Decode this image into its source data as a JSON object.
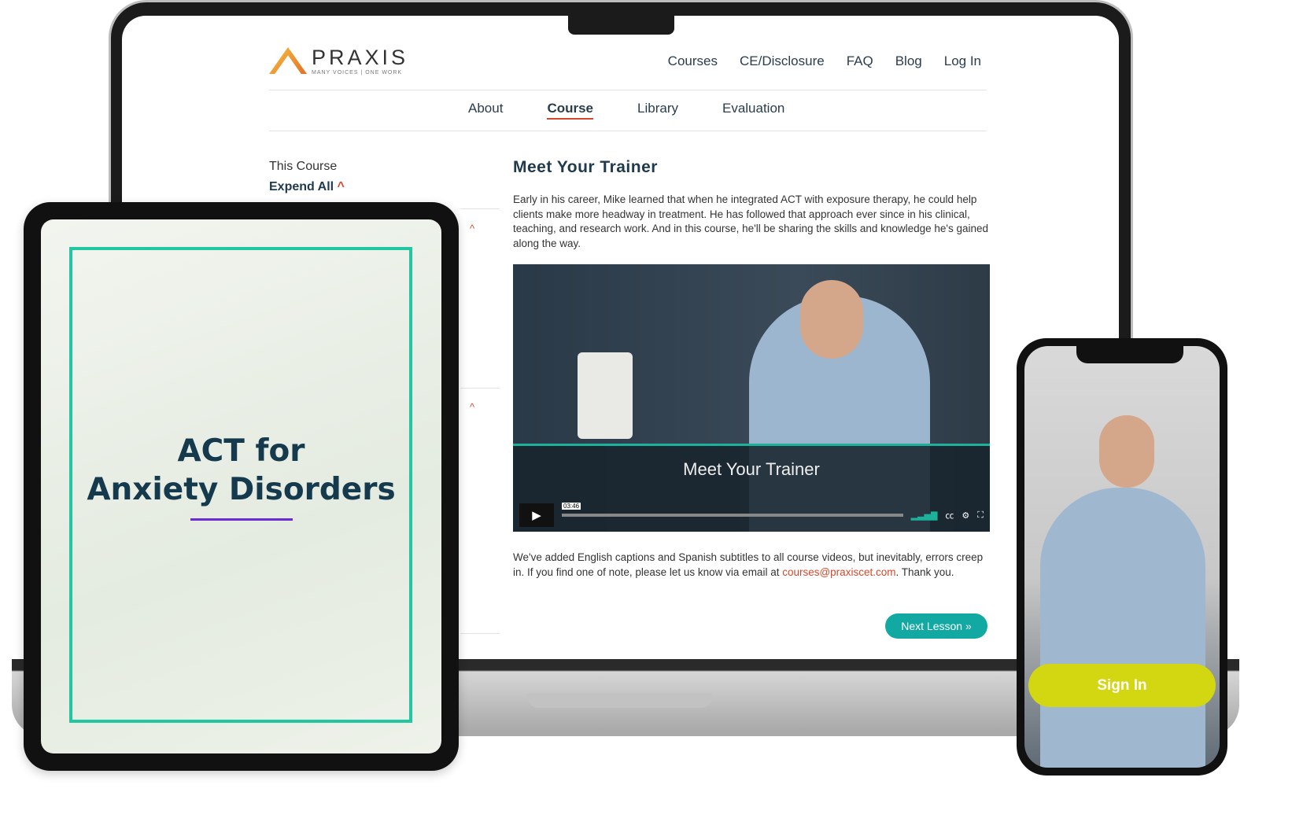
{
  "laptop": {
    "logo": {
      "name": "PRAXIS",
      "tagline": "MANY VOICES | ONE WORK"
    },
    "topnav": [
      "Courses",
      "CE/Disclosure",
      "FAQ",
      "Blog",
      "Log In"
    ],
    "subnav": [
      {
        "label": "About"
      },
      {
        "label": "Course",
        "active": true
      },
      {
        "label": "Library"
      },
      {
        "label": "Evaluation"
      }
    ],
    "sidebar": {
      "title": "This Course",
      "expand": "Expend All"
    },
    "main": {
      "heading": "Meet Your Trainer",
      "intro": "Early in his career, Mike learned that when he integrated ACT with exposure therapy, he could help clients make more headway in treatment. He has followed that approach ever since in his clinical, teaching, and research work. And in this course, he'll be sharing the skills and knowledge he's gained along the way.",
      "video": {
        "title": "Meet Your Trainer",
        "time": "03:46"
      },
      "captions_text": "We've added English captions and Spanish subtitles to all course videos, but inevitably, errors creep in. If you find one of note, please let us know via email at ",
      "email": "courses@praxiscet.com",
      "thanks": ". Thank you.",
      "next_button": "Next Lesson »"
    }
  },
  "tablet": {
    "title_line1": "ACT for",
    "title_line2": "Anxiety Disorders"
  },
  "phone": {
    "sign_in": "Sign In"
  },
  "colors": {
    "accent": "#d5482b",
    "teal": "#13a9a3",
    "frame": "#22c6a1",
    "signin": "#d3d712"
  }
}
